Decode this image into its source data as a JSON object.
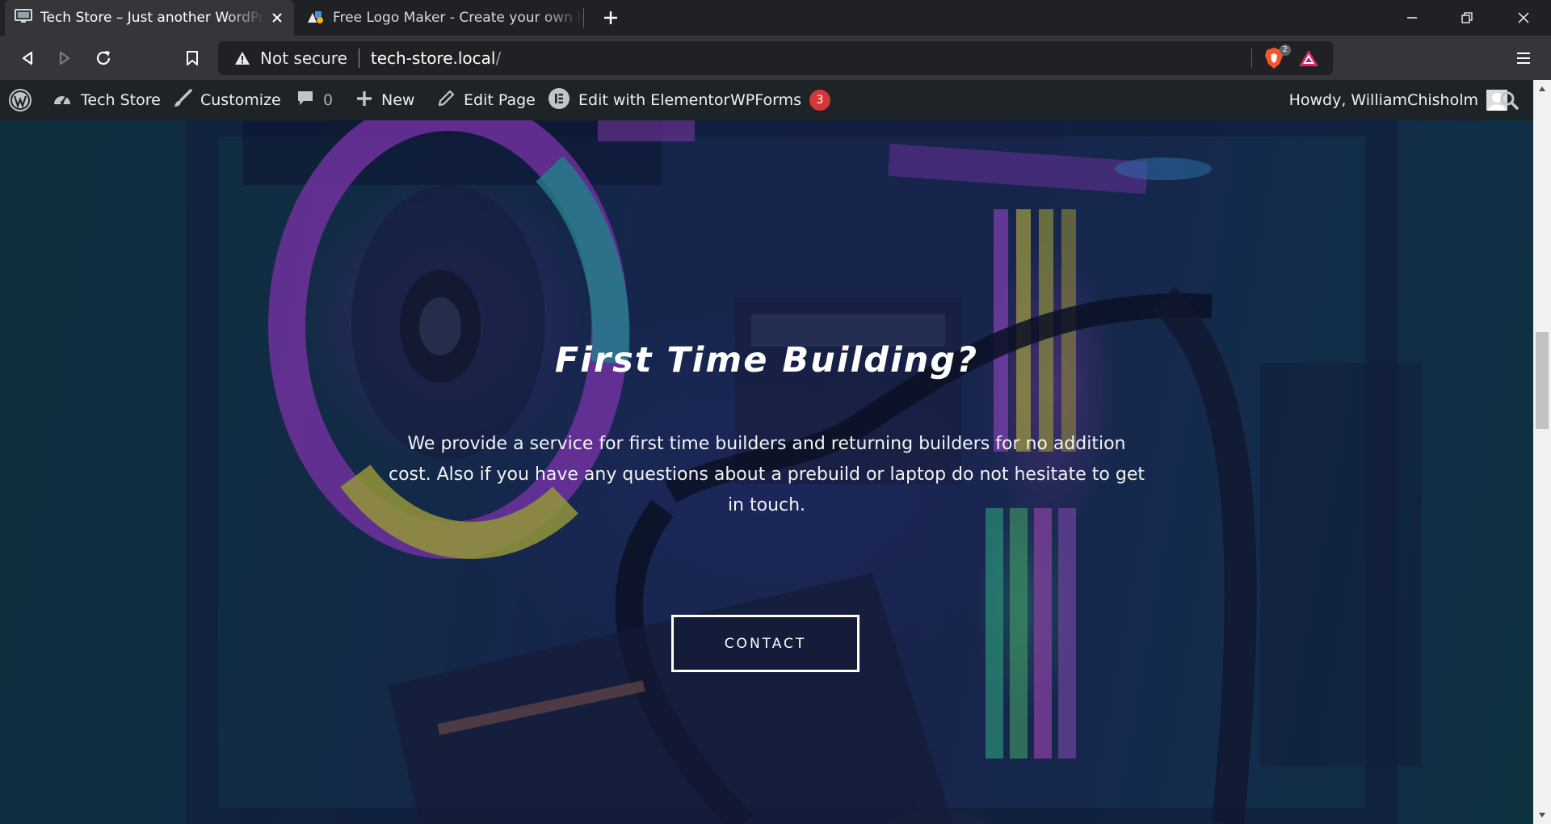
{
  "browser": {
    "tabs": [
      {
        "title": "Tech Store – Just another WordPress site",
        "active": true,
        "favicon": "monitor-icon"
      },
      {
        "title": "Free Logo Maker - Create your own logo",
        "active": false,
        "favicon": "logo-maker-icon"
      }
    ],
    "new_tab_icon": "plus-icon",
    "window_controls": [
      "minimize-icon",
      "restore-icon",
      "close-icon"
    ],
    "security_label": "Not secure",
    "url": "tech-store.local",
    "url_suffix": "/",
    "brave_shield_count": "2"
  },
  "admin_bar": {
    "site_name": "Tech Store",
    "customize": "Customize",
    "comments_count": "0",
    "new": "New",
    "edit_page": "Edit Page",
    "edit_elementor": "Edit with Elementor",
    "wpforms": "WPForms",
    "wpforms_count": "3",
    "howdy": "Howdy, WilliamChisholm"
  },
  "hero": {
    "title": "First Time Building?",
    "text": "We provide a service for first time builders and returning builders for no addition cost. Also if you have any questions about a prebuild or laptop do not hesitate to get in touch.",
    "button": "CONTACT"
  },
  "colors": {
    "tabstrip": "#202124",
    "toolbar": "#35363a",
    "adminbar": "#1d2327",
    "badge": "#d63638",
    "hero_teal": "#0f3d45",
    "hero_navy": "#1d2a57"
  }
}
